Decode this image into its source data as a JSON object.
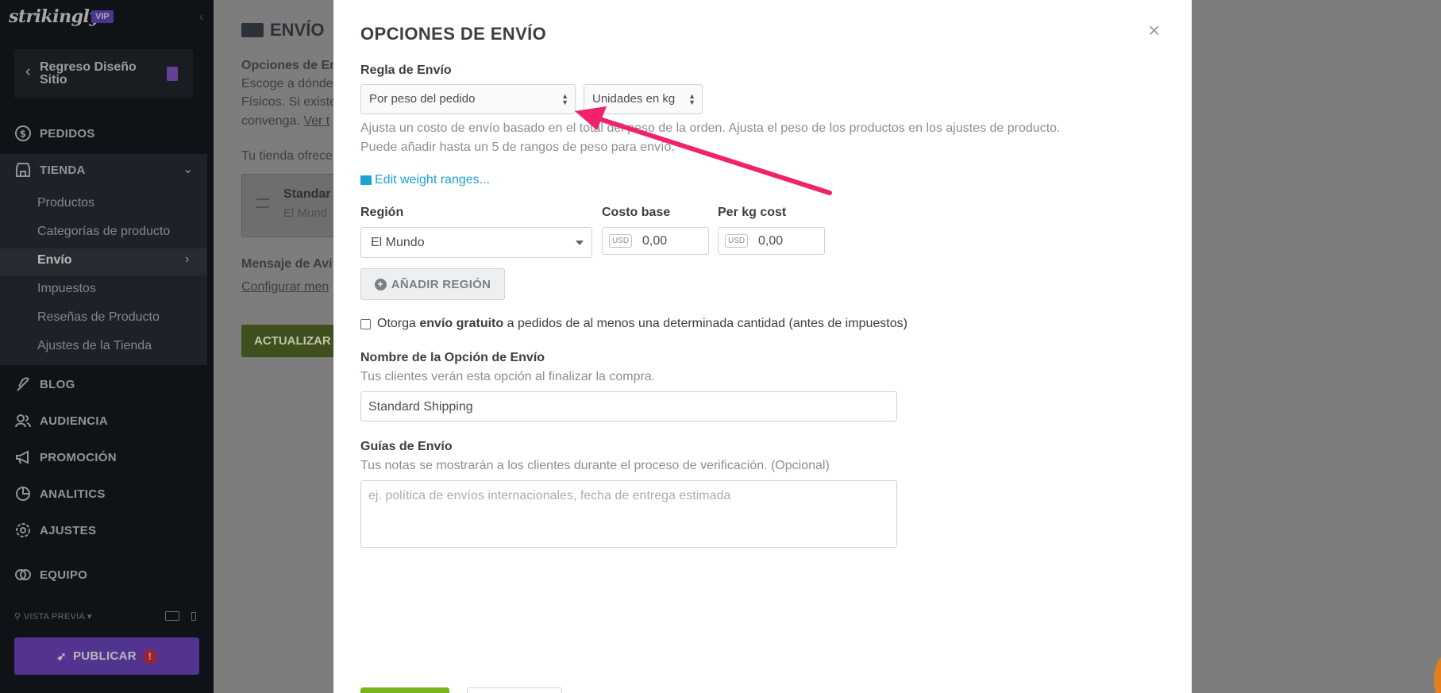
{
  "sidebar": {
    "logo": "strikingly",
    "badge": "VIP",
    "back_label": "Regreso Diseño Sitio",
    "nav": {
      "pedidos": "PEDIDOS",
      "tienda": "TIENDA",
      "blog": "BLOG",
      "audiencia": "AUDIENCIA",
      "promocion": "PROMOCIÓN",
      "analitics": "ANALITICS",
      "ajustes": "AJUSTES",
      "equipo": "EQUIPO"
    },
    "tienda_items": [
      "Productos",
      "Categorías de producto",
      "Envío",
      "Impuestos",
      "Reseñas de Producto",
      "Ajustes de la Tienda"
    ],
    "preview_label": "VISTA PREVIA",
    "publish_label": "PUBLICAR",
    "publish_alert": "!"
  },
  "background_page": {
    "title": "ENVÍO",
    "section_label": "Opciones de En",
    "desc_line1": "Escoge a dónde",
    "desc_line2": "Físicos. Si existe",
    "desc_line3": "convenga.",
    "desc_link": "Ver t",
    "offer_text": "Tu tienda ofrece",
    "card_title": "Standar",
    "card_sub": "El Mund",
    "message_label": "Mensaje de Avi",
    "message_link": "Configurar men",
    "update_button": "ACTUALIZAR"
  },
  "modal": {
    "title": "OPCIONES DE ENVÍO",
    "close_glyph": "×",
    "rule_label": "Regla de Envío",
    "rule_select_value": "Por peso del pedido",
    "unit_select_value": "Unidades en kg",
    "rule_help_line1": "Ajusta un costo de envío basado en el total del peso de la orden. Ajusta el peso de los productos en los ajustes de producto.",
    "rule_help_line2": "Puede añadir hasta un 5 de rangos de peso para envío.",
    "edit_ranges_link": "Edit weight ranges...",
    "region_label": "Región",
    "base_cost_label": "Costo base",
    "per_kg_label": "Per kg cost",
    "region_value": "El Mundo",
    "currency": "USD",
    "base_cost_value": "0,00",
    "per_kg_value": "0,00",
    "add_region_button": "AÑADIR REGIÓN",
    "free_shipping_pre": "Otorga",
    "free_shipping_bold": "envío gratuito",
    "free_shipping_post": "a pedidos de al menos una determinada cantidad (antes de impuestos)",
    "name_label": "Nombre de la Opción de Envío",
    "name_help": "Tus clientes verán esta opción al finalizar la compra.",
    "name_value": "Standard Shipping",
    "guides_label": "Guías de Envío",
    "guides_help": "Tus notas se mostrarán a los clientes durante el proceso de verificación. (Opcional)",
    "guides_placeholder": "ej. política de envíos internacionales, fecha de entrega estimada"
  },
  "colors": {
    "annotation_arrow": "#f0226b",
    "link": "#1ea2d6",
    "publish": "#7347c8",
    "save_green": "#7ab51d"
  }
}
